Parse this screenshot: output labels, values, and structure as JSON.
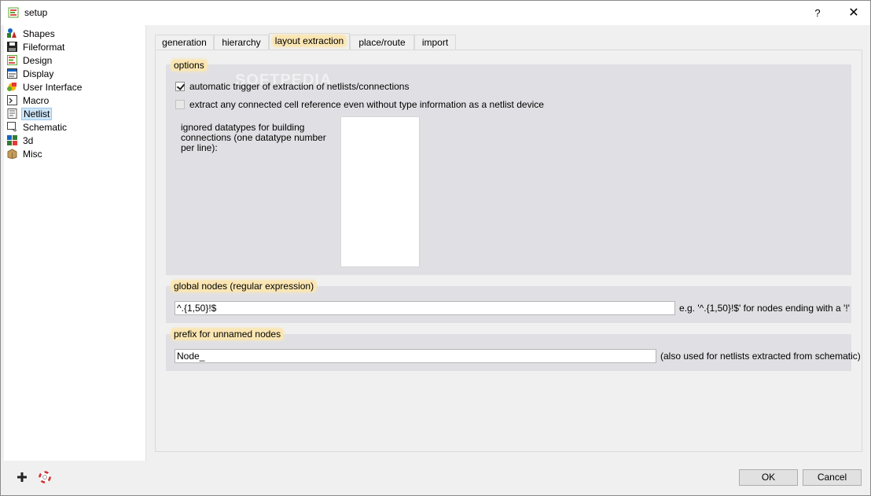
{
  "window": {
    "title": "setup",
    "help_label": "?",
    "close_label": "✕"
  },
  "sidebar": {
    "items": [
      {
        "label": "Shapes",
        "icon": "shapes-icon"
      },
      {
        "label": "Fileformat",
        "icon": "floppy-icon"
      },
      {
        "label": "Design",
        "icon": "design-icon"
      },
      {
        "label": "Display",
        "icon": "display-icon"
      },
      {
        "label": "User Interface",
        "icon": "user-interface-icon"
      },
      {
        "label": "Macro",
        "icon": "macro-icon"
      },
      {
        "label": "Netlist",
        "icon": "netlist-icon",
        "selected": true
      },
      {
        "label": "Schematic",
        "icon": "schematic-icon"
      },
      {
        "label": "3d",
        "icon": "3d-icon"
      },
      {
        "label": "Misc",
        "icon": "misc-icon"
      }
    ]
  },
  "tabs": [
    {
      "label": "generation"
    },
    {
      "label": "hierarchy"
    },
    {
      "label": "layout extraction",
      "active": true
    },
    {
      "label": "place/route"
    },
    {
      "label": "import"
    }
  ],
  "options": {
    "title": "options",
    "auto_trigger_label": "automatic trigger of extraction of netlists/connections",
    "auto_trigger_checked": true,
    "extract_any_label": "extract any connected cell reference even without type information as a netlist device",
    "extract_any_checked": false,
    "ignored_datatypes_label": "ignored datatypes for building connections (one datatype number per line):"
  },
  "global_nodes": {
    "title": "global nodes (regular expression)",
    "value": "^.{1,50}!$",
    "hint": "e.g. '^.{1,50}!$' for nodes ending with a '!'"
  },
  "prefix": {
    "title": "prefix for unnamed nodes",
    "value": "Node_",
    "hint": "(also used for netlists extracted from schematic)"
  },
  "footer": {
    "add_icon": "plus-icon",
    "help_icon": "lifebuoy-icon",
    "ok_label": "OK",
    "cancel_label": "Cancel"
  },
  "watermark": "SOFTPEDIA"
}
